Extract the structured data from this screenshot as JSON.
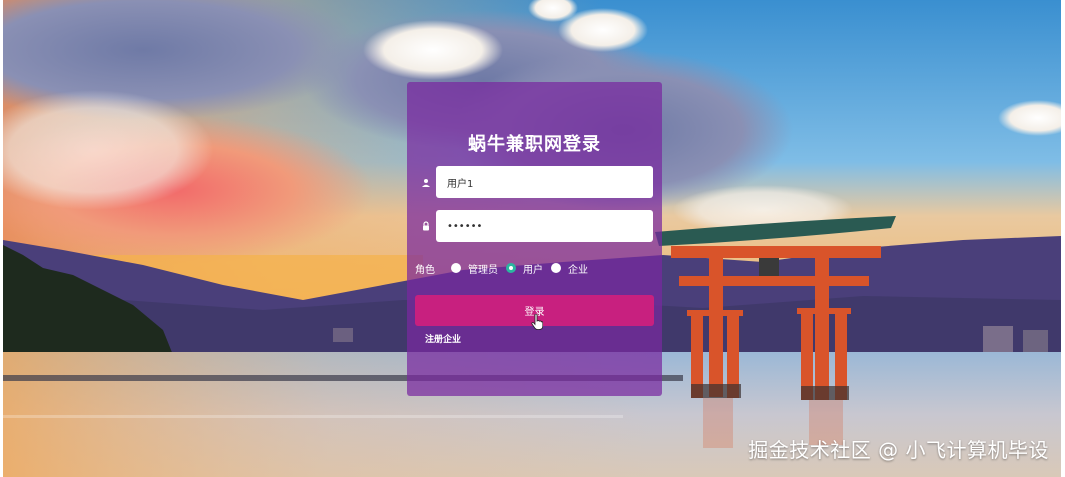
{
  "login": {
    "title": "蜗牛兼职网登录",
    "username_value": "用户1",
    "password_value": "••••••",
    "role_label": "角色",
    "roles": [
      "管理员",
      "用户",
      "企业"
    ],
    "selected_role": "用户",
    "submit_label": "登录",
    "register_link": "注册企业"
  },
  "watermark": "掘金技术社区 @ 小飞计算机毕设",
  "icons": {
    "username": "user-icon",
    "password": "lock-icon",
    "cursor": "hand-pointer-icon"
  },
  "colors": {
    "panel": "#7828a0",
    "button": "#c8207f",
    "radio_checked": "#2bb6a0",
    "gate": "#d9542a"
  }
}
